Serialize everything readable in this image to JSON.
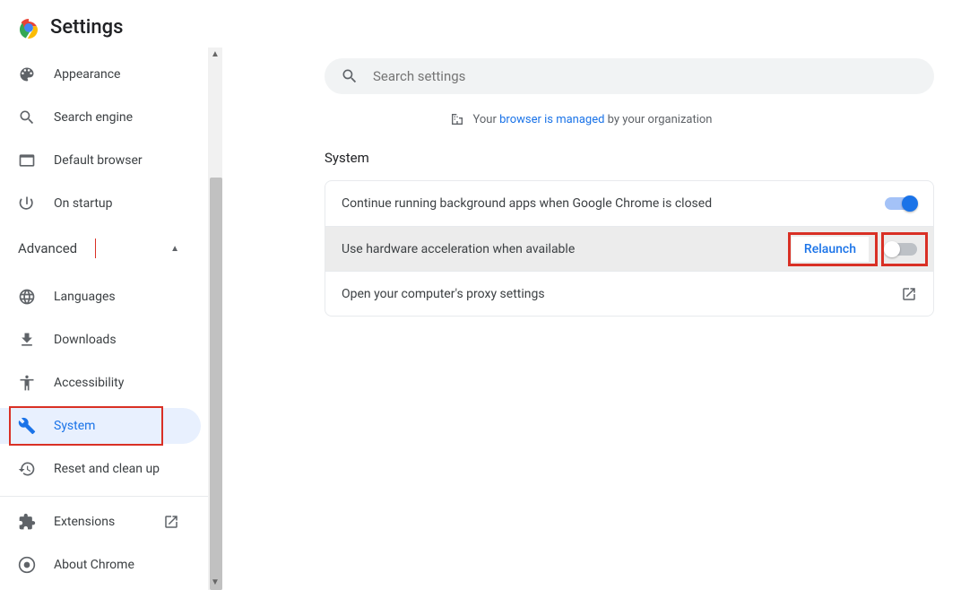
{
  "header": {
    "title": "Settings"
  },
  "search": {
    "placeholder": "Search settings"
  },
  "managed": {
    "prefix": "Your ",
    "link": "browser is managed",
    "suffix": " by your organization"
  },
  "sidebar": {
    "appearance": "Appearance",
    "search_engine": "Search engine",
    "default_browser": "Default browser",
    "on_startup": "On startup",
    "advanced": "Advanced",
    "languages": "Languages",
    "downloads": "Downloads",
    "accessibility": "Accessibility",
    "system": "System",
    "reset": "Reset and clean up",
    "extensions": "Extensions",
    "about": "About Chrome"
  },
  "section": {
    "title": "System"
  },
  "rows": {
    "bg_apps": "Continue running background apps when Google Chrome is closed",
    "hw_accel": "Use hardware acceleration when available",
    "relaunch": "Relaunch",
    "proxy": "Open your computer's proxy settings"
  },
  "toggles": {
    "bg_apps": true,
    "hw_accel": false
  }
}
